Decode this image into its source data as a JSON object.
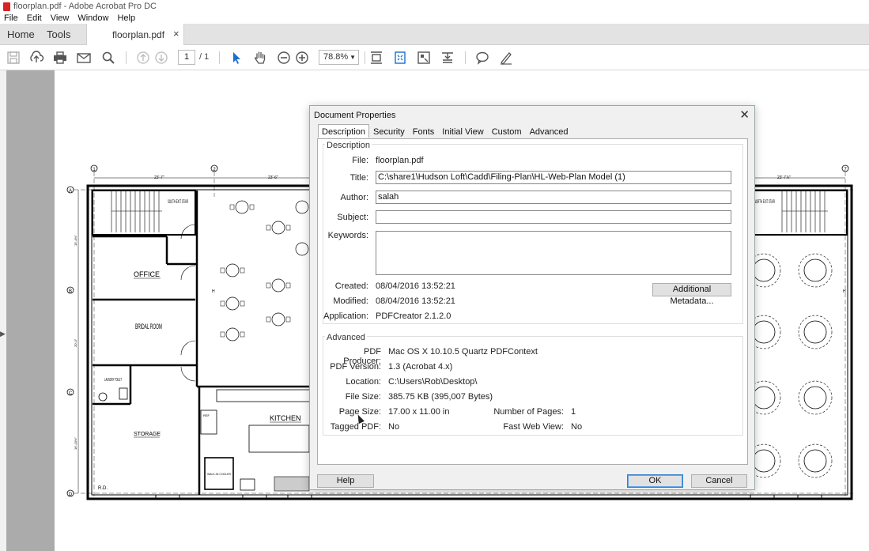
{
  "window": {
    "title": "floorplan.pdf - Adobe Acrobat Pro DC"
  },
  "menu": [
    "File",
    "Edit",
    "View",
    "Window",
    "Help"
  ],
  "tabs": {
    "home": "Home",
    "tools": "Tools",
    "document": "floorplan.pdf",
    "close": "×"
  },
  "toolbar": {
    "page_current": "1",
    "page_total": "/ 1",
    "zoom": "78.8%",
    "icons": [
      "save-icon",
      "upload-icon",
      "print-icon",
      "mail-icon",
      "search-icon",
      "prev-page-icon",
      "next-page-icon",
      "select-icon",
      "hand-icon",
      "zoom-out-icon",
      "zoom-in-icon",
      "scroll-mode-icon",
      "fit-page-icon",
      "full-screen-icon",
      "read-mode-icon",
      "comment-icon",
      "sign-icon"
    ]
  },
  "floorplan": {
    "grid_top": [
      "1",
      "2",
      "7"
    ],
    "grid_left": [
      "A",
      "B",
      "C",
      "D"
    ],
    "dims": [
      "23'-7\"",
      "23'-6\"",
      "23'-7⅞\""
    ],
    "rooms": [
      "SOUTH EXIT STAIR",
      "OFFICE",
      "BRIDAL ROOM",
      "STORAGE",
      "KITCHEN",
      "NORTH EXIT STAIR",
      "LAUNDRY TOILET",
      "WALK-IN COOLER",
      "R.D."
    ],
    "vertical_dims": [
      "15'-4½\"",
      "20'-0\"",
      "16'-10½\""
    ],
    "small_labels": [
      "H",
      "H"
    ]
  },
  "dialog": {
    "title": "Document Properties",
    "close": "✕",
    "tabs": [
      "Description",
      "Security",
      "Fonts",
      "Initial View",
      "Custom",
      "Advanced"
    ],
    "description": {
      "group_title": "Description",
      "file_label": "File:",
      "file_value": "floorplan.pdf",
      "title_label": "Title:",
      "title_value": "C:\\share1\\Hudson Loft\\Cadd\\Filing-Plan\\HL-Web-Plan Model (1)",
      "author_label": "Author:",
      "author_value": "salah",
      "subject_label": "Subject:",
      "subject_value": "",
      "keywords_label": "Keywords:",
      "keywords_value": "",
      "created_label": "Created:",
      "created_value": "08/04/2016 13:52:21",
      "modified_label": "Modified:",
      "modified_value": "08/04/2016 13:52:21",
      "application_label": "Application:",
      "application_value": "PDFCreator 2.1.2.0",
      "metadata_button": "Additional Metadata..."
    },
    "advanced": {
      "group_title": "Advanced",
      "producer_label": "PDF Producer:",
      "producer_value": "Mac OS X 10.10.5 Quartz PDFContext",
      "version_label": "PDF Version:",
      "version_value": "1.3 (Acrobat 4.x)",
      "location_label": "Location:",
      "location_value": "C:\\Users\\Rob\\Desktop\\",
      "size_label": "File Size:",
      "size_value": "385.75 KB (395,007 Bytes)",
      "pagesize_label": "Page Size:",
      "pagesize_value": "17.00 x 11.00 in",
      "numpages_label": "Number of Pages:",
      "numpages_value": "1",
      "tagged_label": "Tagged PDF:",
      "tagged_value": "No",
      "fastweb_label": "Fast Web View:",
      "fastweb_value": "No"
    },
    "buttons": {
      "help": "Help",
      "ok": "OK",
      "cancel": "Cancel"
    }
  }
}
